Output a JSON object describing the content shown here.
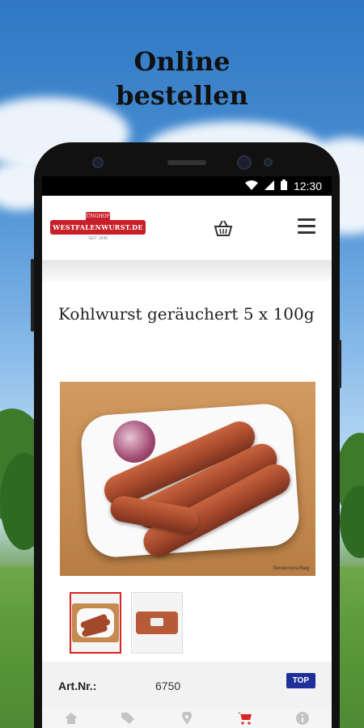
{
  "promo": {
    "headline_line1": "Online",
    "headline_line2": "bestellen"
  },
  "status_bar": {
    "time": "12:30"
  },
  "header": {
    "logo_top": "KÜNGHOFF",
    "logo_main": "WESTFALENWURST.DE",
    "logo_bottom": "SEIT 1848",
    "cart_icon": "basket-icon",
    "menu_icon": "hamburger-menu-icon"
  },
  "product": {
    "title": "Kohlwurst geräuchert 5 x 100g",
    "image_caption": "Serviervorschlag",
    "article_label": "Art.Nr.:",
    "article_number": "6750",
    "badge": "TOP"
  },
  "bottom_nav": {
    "items": [
      {
        "icon": "home-icon",
        "active": false
      },
      {
        "icon": "tags-icon",
        "active": false
      },
      {
        "icon": "map-marker-icon",
        "active": false
      },
      {
        "icon": "cart-icon",
        "active": true
      },
      {
        "icon": "info-icon",
        "active": false
      }
    ]
  },
  "colors": {
    "brand_red": "#c8202a",
    "badge_blue": "#1f2f9a",
    "active_nav": "#dd2222"
  }
}
